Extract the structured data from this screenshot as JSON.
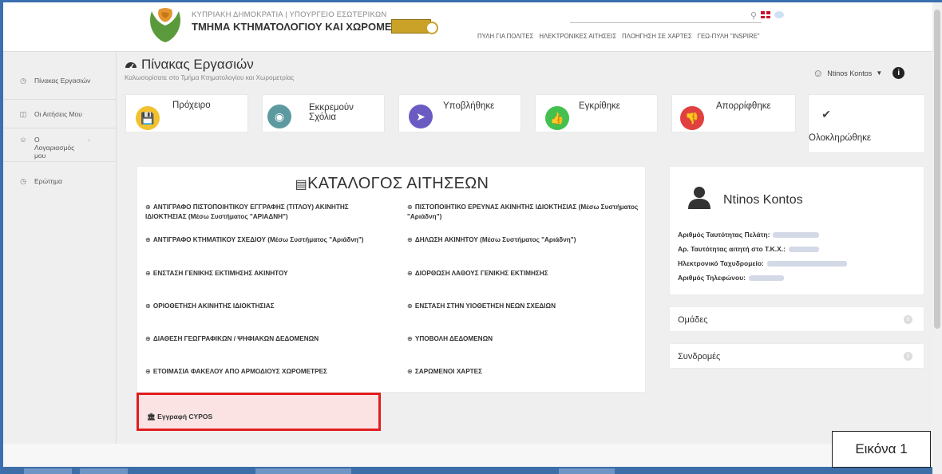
{
  "header": {
    "ministry": "ΚΥΠΡΙΑΚΗ ΔΗΜΟΚΡΑΤΙΑ | ΥΠΟΥΡΓΕΙΟ ΕΣΩΤΕΡΙΚΩΝ",
    "department": "ΤΜΗΜΑ ΚΤΗΜΑΤΟΛΟΓΙΟΥ ΚΑΙ ΧΩΡΟΜΕΤΡΙΑΣ",
    "nav": [
      "ΠΥΛΗ ΓΙΑ ΠΟΛΙΤΕΣ",
      "ΗΛΕΚΤΡΟΝΙΚΕΣ ΑΙΤΗΣΕΙΣ",
      "ΠΛΟΗΓΗΣΗ ΣΕ ΧΑΡΤΕΣ",
      "ΓΕΩ-ΠΥΛΗ \"INSPIRE\""
    ]
  },
  "sidebar": {
    "items": [
      {
        "label": "Πίνακας Εργασιών",
        "icon": "clock-icon"
      },
      {
        "label": "Οι Αιτήσεις Μου",
        "icon": "inbox-icon"
      },
      {
        "label": "Ο Λογαριασμός μου",
        "icon": "user-icon"
      },
      {
        "label": "Ερώτημα",
        "icon": "question-icon"
      }
    ]
  },
  "dashboard": {
    "title": "Πίνακας Εργασιών",
    "subtitle": "Καλωσορίσατε στο Τμήμα Κτηματολογίου και Χωρομετρίας",
    "user_menu": "Ntinos Kontos"
  },
  "status_cards": [
    {
      "label": "Πρόχειρο",
      "color": "#f2c12e",
      "icon": "save-icon"
    },
    {
      "label": "Εκκρεμούν Σχόλια",
      "color": "#5c9aa0",
      "icon": "comment-icon"
    },
    {
      "label": "Υποβλήθηκε",
      "color": "#6a5bc2",
      "icon": "send-icon"
    },
    {
      "label": "Εγκρίθηκε",
      "color": "#43c04e",
      "icon": "thumbs-up-icon"
    },
    {
      "label": "Απορρίφθηκε",
      "color": "#e0413f",
      "icon": "thumbs-down-icon"
    },
    {
      "label": "Ολοκληρώθηκε",
      "color": "#ffffff",
      "icon": "check-circle-icon"
    }
  ],
  "catalog": {
    "title": "ΚΑΤΑΛΟΓΟΣ ΑΙΤΗΣΕΩΝ",
    "bullet": "⊕",
    "left": [
      "ΑΝΤΙΓΡΑΦΟ ΠΙΣΤΟΠΟΙΗΤΙΚΟΥ ΕΓΓΡΑΦΗΣ (ΤΙΤΛΟΥ) ΑΚΙΝΗΤΗΣ ΙΔΙΟΚΤΗΣΙΑΣ (Μέσω Συστήματος \"ΑΡΙΑΔΝΗ\")",
      "ΑΝΤΙΓΡΑΦΟ ΚΤΗΜΑΤΙΚΟΥ ΣΧΕΔΙΟΥ (Μέσω Συστήματος \"Αριάδνη\")",
      "ΕΝΣΤΑΣΗ ΓΕΝΙΚΗΣ ΕΚΤΙΜΗΣΗΣ ΑΚΙΝΗΤΟΥ",
      "ΟΡΙΟΘΕΤΗΣΗ ΑΚΙΝΗΤΗΣ ΙΔΙΟΚΤΗΣΙΑΣ",
      "ΔΙΑΘΕΣΗ ΓΕΩΓΡΑΦΙΚΩΝ / ΨΗΦΙΑΚΩΝ ΔΕΔΟΜΕΝΩΝ",
      "ΕΤΟΙΜΑΣΙΑ ΦΑΚΕΛΟΥ ΑΠΟ ΑΡΜΟΔΙΟΥΣ ΧΩΡΟΜΕΤΡΕΣ"
    ],
    "right": [
      "ΠΙΣΤΟΠΟΙΗΤΙΚΟ ΕΡΕΥΝΑΣ ΑΚΙΝΗΤΗΣ ΙΔΙΟΚΤΗΣΙΑΣ (Μέσω Συστήματος \"Αριάδνη\")",
      "ΔΗΛΩΣΗ ΑΚΙΝΗΤΟΥ (Μέσω Συστήματος \"Αριάδνη\")",
      "ΔΙΟΡΘΩΣΗ ΛΑΘΟΥΣ ΓΕΝΙΚΗΣ ΕΚΤΙΜΗΣΗΣ",
      "ΕΝΣΤΑΣΗ ΣΤΗΝ ΥΙΟΘΕΤΗΣΗ ΝΕΩΝ ΣΧΕΔΙΩΝ",
      "ΥΠΟΒΟΛΗ ΔΕΔΟΜΕΝΩΝ",
      "ΣΑΡΩΜΕΝΟΙ ΧΑΡΤΕΣ"
    ],
    "cypos": "Εγγραφή CYPOS"
  },
  "user_panel": {
    "name": "Ntinos Kontos",
    "fields": [
      "Αριθμός Ταυτότητας Πελάτη:",
      "Αρ. Ταυτότητας αιτητή στο Τ.Κ.Χ.:",
      "Ηλεκτρονικό Ταχυδρομείο:",
      "Αριθμός Τηλεφώνου:"
    ]
  },
  "groups": {
    "label": "Ομάδες",
    "count": "0"
  },
  "subscriptions": {
    "label": "Συνδρομές",
    "count": "0"
  },
  "caption": "Εικόνα 1"
}
